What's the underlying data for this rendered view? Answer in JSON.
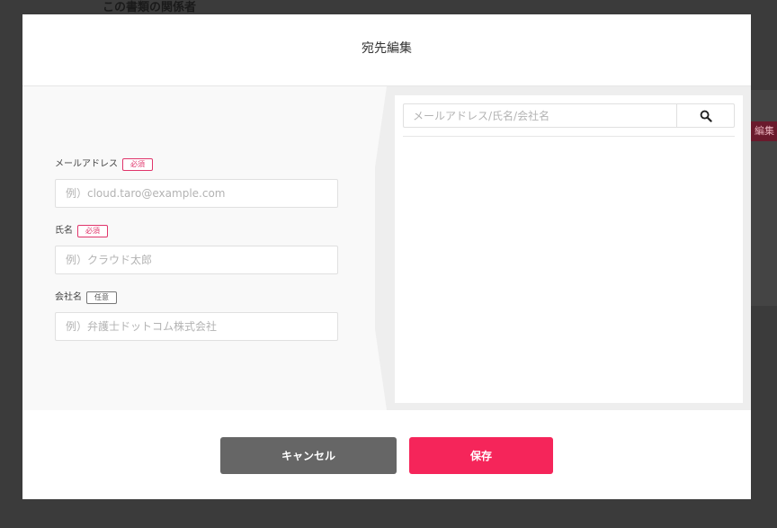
{
  "background": {
    "section_heading": "この書類の関係者",
    "edit_tag": "編集"
  },
  "modal": {
    "title": "宛先編集",
    "form": {
      "email": {
        "label": "メールアドレス",
        "badge": "必須",
        "placeholder": "例）cloud.taro@example.com",
        "value": ""
      },
      "name": {
        "label": "氏名",
        "badge": "必須",
        "placeholder": "例）クラウド太郎",
        "value": ""
      },
      "company": {
        "label": "会社名",
        "badge": "任意",
        "placeholder": "例）弁護士ドットコム株式会社",
        "value": ""
      }
    },
    "search": {
      "placeholder": "メールアドレス/氏名/会社名",
      "value": "",
      "button_icon": "search-icon",
      "results": []
    },
    "footer": {
      "cancel_label": "キャンセル",
      "save_label": "保存"
    }
  },
  "colors": {
    "accent": "#f5255a",
    "required_badge": "#e0356b",
    "cancel_button": "#666666",
    "overlay": "#3b3b3b"
  }
}
